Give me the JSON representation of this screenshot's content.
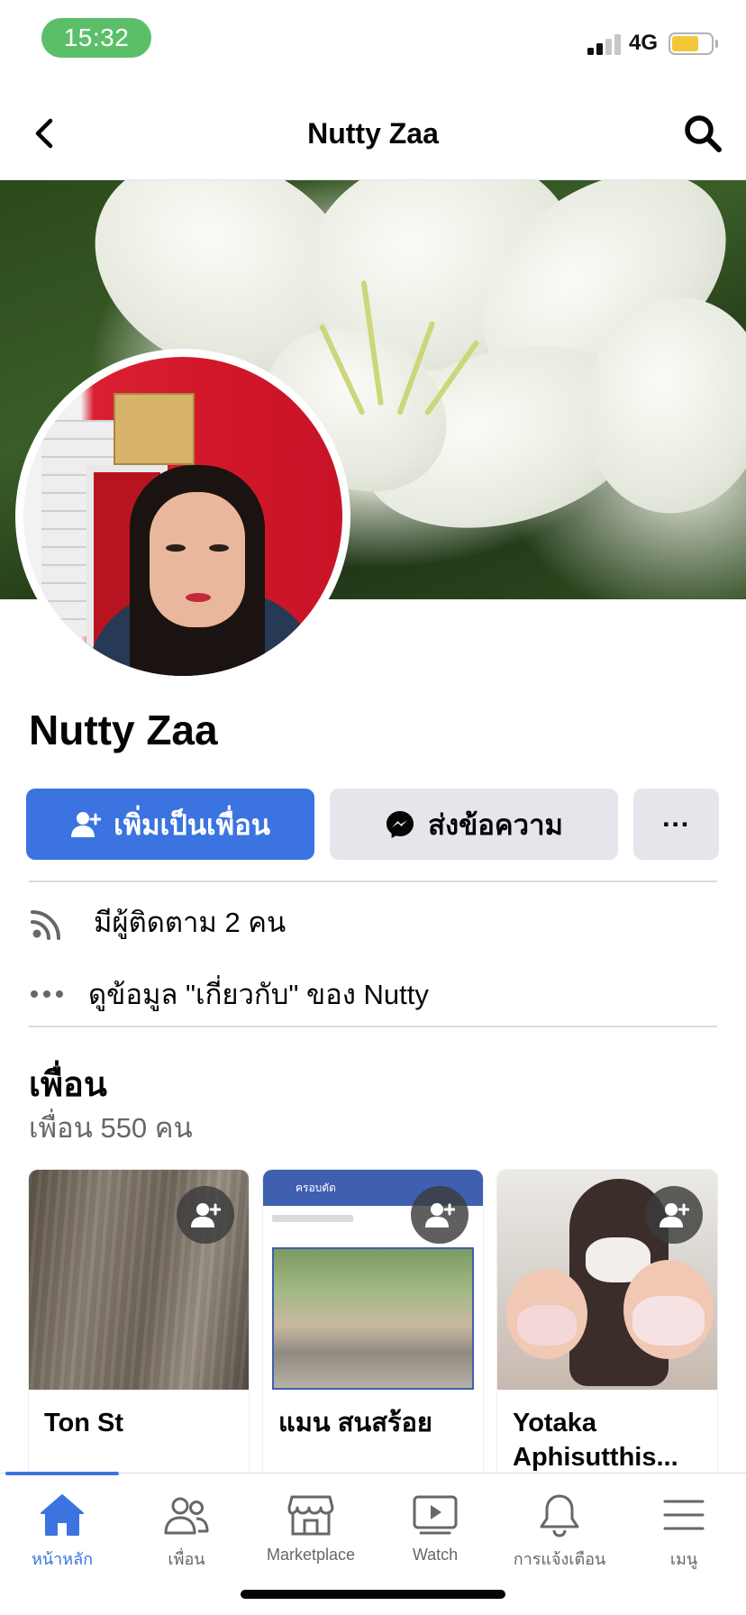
{
  "status_bar": {
    "time": "15:32",
    "network": "4G",
    "battery_level": 0.7,
    "colors": {
      "time_pill": "#5bbf6a",
      "battery_fill": "#f4c63a"
    }
  },
  "header": {
    "title": "Nutty Zaa",
    "back_icon": "chevron-left-icon",
    "search_icon": "search-icon"
  },
  "profile": {
    "name": "Nutty Zaa"
  },
  "actions": {
    "add_friend_label": "เพิ่มเป็นเพื่อน",
    "message_label": "ส่งข้อความ",
    "more_label": "···",
    "accent_color": "#3b73e0"
  },
  "info": {
    "followers_text": "มีผู้ติดตาม 2 คน",
    "about_text": "ดูข้อมูล \"เกี่ยวกับ\" ของ Nutty"
  },
  "friends": {
    "title": "เพื่อน",
    "count_text": "เพื่อน 550 คน",
    "cards": [
      {
        "name": "Ton St"
      },
      {
        "name": "แมน สนสร้อย",
        "photo_header": "ครอบตัด"
      },
      {
        "name": "Yotaka Aphisutthis..."
      }
    ]
  },
  "tab_bar": {
    "tabs": [
      {
        "label": "หน้าหลัก",
        "icon": "home-icon",
        "active": true
      },
      {
        "label": "เพื่อน",
        "icon": "friends-icon",
        "active": false
      },
      {
        "label": "Marketplace",
        "icon": "marketplace-icon",
        "active": false
      },
      {
        "label": "Watch",
        "icon": "watch-icon",
        "active": false
      },
      {
        "label": "การแจ้งเตือน",
        "icon": "bell-icon",
        "active": false
      },
      {
        "label": "เมนู",
        "icon": "menu-icon",
        "active": false
      }
    ]
  }
}
